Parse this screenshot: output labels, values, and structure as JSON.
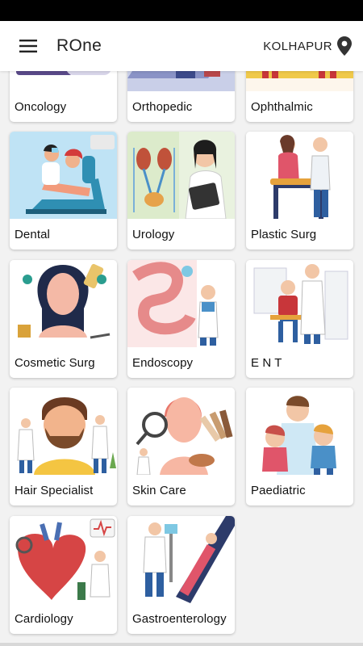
{
  "app": {
    "title": "ROne"
  },
  "location": {
    "city": "KOLHAPUR"
  },
  "specialties": [
    {
      "label": "Oncology",
      "icon": "oncology-illustration"
    },
    {
      "label": "Orthopedic",
      "icon": "orthopedic-illustration"
    },
    {
      "label": "Ophthalmic",
      "icon": "ophthalmic-illustration"
    },
    {
      "label": "Dental",
      "icon": "dental-illustration"
    },
    {
      "label": "Urology",
      "icon": "urology-illustration"
    },
    {
      "label": "Plastic Surg",
      "icon": "plastic-surgery-illustration"
    },
    {
      "label": "Cosmetic Surg",
      "icon": "cosmetic-surgery-illustration"
    },
    {
      "label": "Endoscopy",
      "icon": "endoscopy-illustration"
    },
    {
      "label": "E N T",
      "icon": "ent-illustration"
    },
    {
      "label": "Hair Specialist",
      "icon": "hair-specialist-illustration"
    },
    {
      "label": "Skin Care",
      "icon": "skin-care-illustration"
    },
    {
      "label": "Paediatric",
      "icon": "paediatric-illustration"
    },
    {
      "label": "Cardiology",
      "icon": "cardiology-illustration"
    },
    {
      "label": "Gastroenterology",
      "icon": "gastroenterology-illustration"
    }
  ]
}
